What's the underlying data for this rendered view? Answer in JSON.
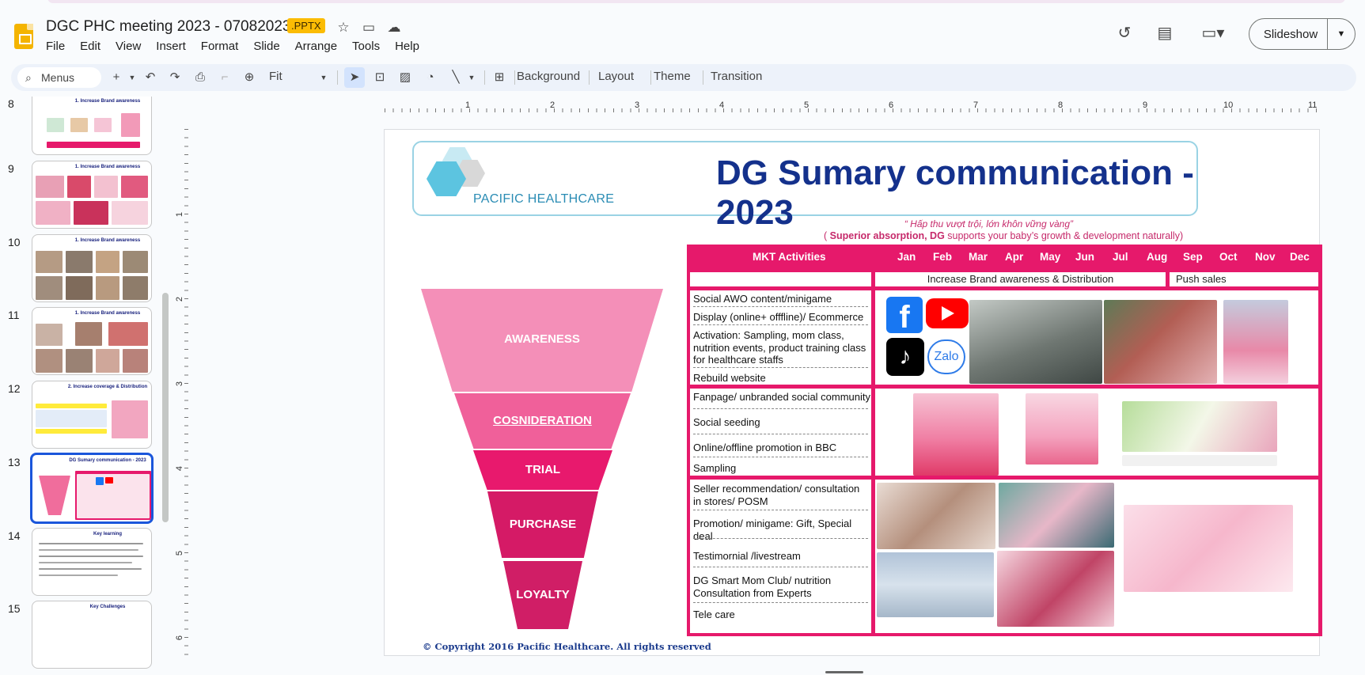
{
  "app": {
    "doc_title": "DGC PHC meeting 2023 - 07082023",
    "file_badge": ".PPTX",
    "menus": [
      "File",
      "Edit",
      "View",
      "Insert",
      "Format",
      "Slide",
      "Arrange",
      "Tools",
      "Help"
    ],
    "slideshow_label": "Slideshow"
  },
  "toolbar": {
    "search_label": "Menus",
    "zoom": "Fit",
    "background": "Background",
    "layout": "Layout",
    "theme": "Theme",
    "transition": "Transition"
  },
  "filmstrip": {
    "slides": [
      {
        "num": "8",
        "title": "1. Increase Brand awareness"
      },
      {
        "num": "9",
        "title": "1. Increase Brand awareness"
      },
      {
        "num": "10",
        "title": "1. Increase Brand awareness"
      },
      {
        "num": "11",
        "title": "1. Increase Brand awareness"
      },
      {
        "num": "12",
        "title": "2. Increase coverage & Distribution"
      },
      {
        "num": "13",
        "title": "DG Sumary communication - 2023"
      },
      {
        "num": "14",
        "title": "Key learning"
      },
      {
        "num": "15",
        "title": "Key Challenges"
      }
    ]
  },
  "rulers": {
    "h": [
      "1",
      "2",
      "3",
      "4",
      "5",
      "6",
      "7",
      "8",
      "9",
      "10",
      "11"
    ],
    "v": [
      "1",
      "2",
      "3",
      "4",
      "5",
      "6"
    ]
  },
  "slide": {
    "logo_text": "PACIFIC HEALTHCARE",
    "title": "DG Sumary communication - 2023",
    "slogan_vi": "“ Hấp thu vượt trội, lớn khôn vững vàng”",
    "slogan_en_prefix": "( ",
    "slogan_en_bold": "Superior absorption, DG",
    "slogan_en_rest": " supports your baby’s growth & development naturally)",
    "funnel": [
      "AWARENESS",
      "COSNIDERATION",
      "TRIAL",
      "PURCHASE",
      "LOYALTY"
    ],
    "table": {
      "header": "MKT Activities",
      "months": [
        "Jan",
        "Feb",
        "Mar",
        "Apr",
        "May",
        "Jun",
        "Jul",
        "Aug",
        "Sep",
        "Oct",
        "Nov",
        "Dec"
      ],
      "phase1": "Increase Brand awareness & Distribution",
      "phase2": "Push sales",
      "awareness": [
        "Social AWO content/minigame",
        "Display (online+ offfline)/ Ecommerce",
        "Activation: Sampling, mom class, nutrition events, product training class for healthcare staffs",
        "Rebuild website"
      ],
      "consideration": [
        "Fanpage/ unbranded social community",
        "Social seeding",
        "Online/offline promotion in BBC",
        "Sampling"
      ],
      "purchase": [
        "Seller recommendation/ consultation in stores/ POSM",
        "Promotion/ minigame: Gift, Special deal",
        "Testimornial /livestream",
        "DG Smart Mom Club/ nutrition Consultation from Experts",
        "Tele care"
      ]
    },
    "logos": {
      "zalo": "Zalo"
    },
    "copyright": "© Copyright 2016 Pacific Healthcare. All rights reserved"
  },
  "colors": {
    "magenta": "#e6196b",
    "navy": "#14318c",
    "pink_light": "#f48fb8"
  }
}
